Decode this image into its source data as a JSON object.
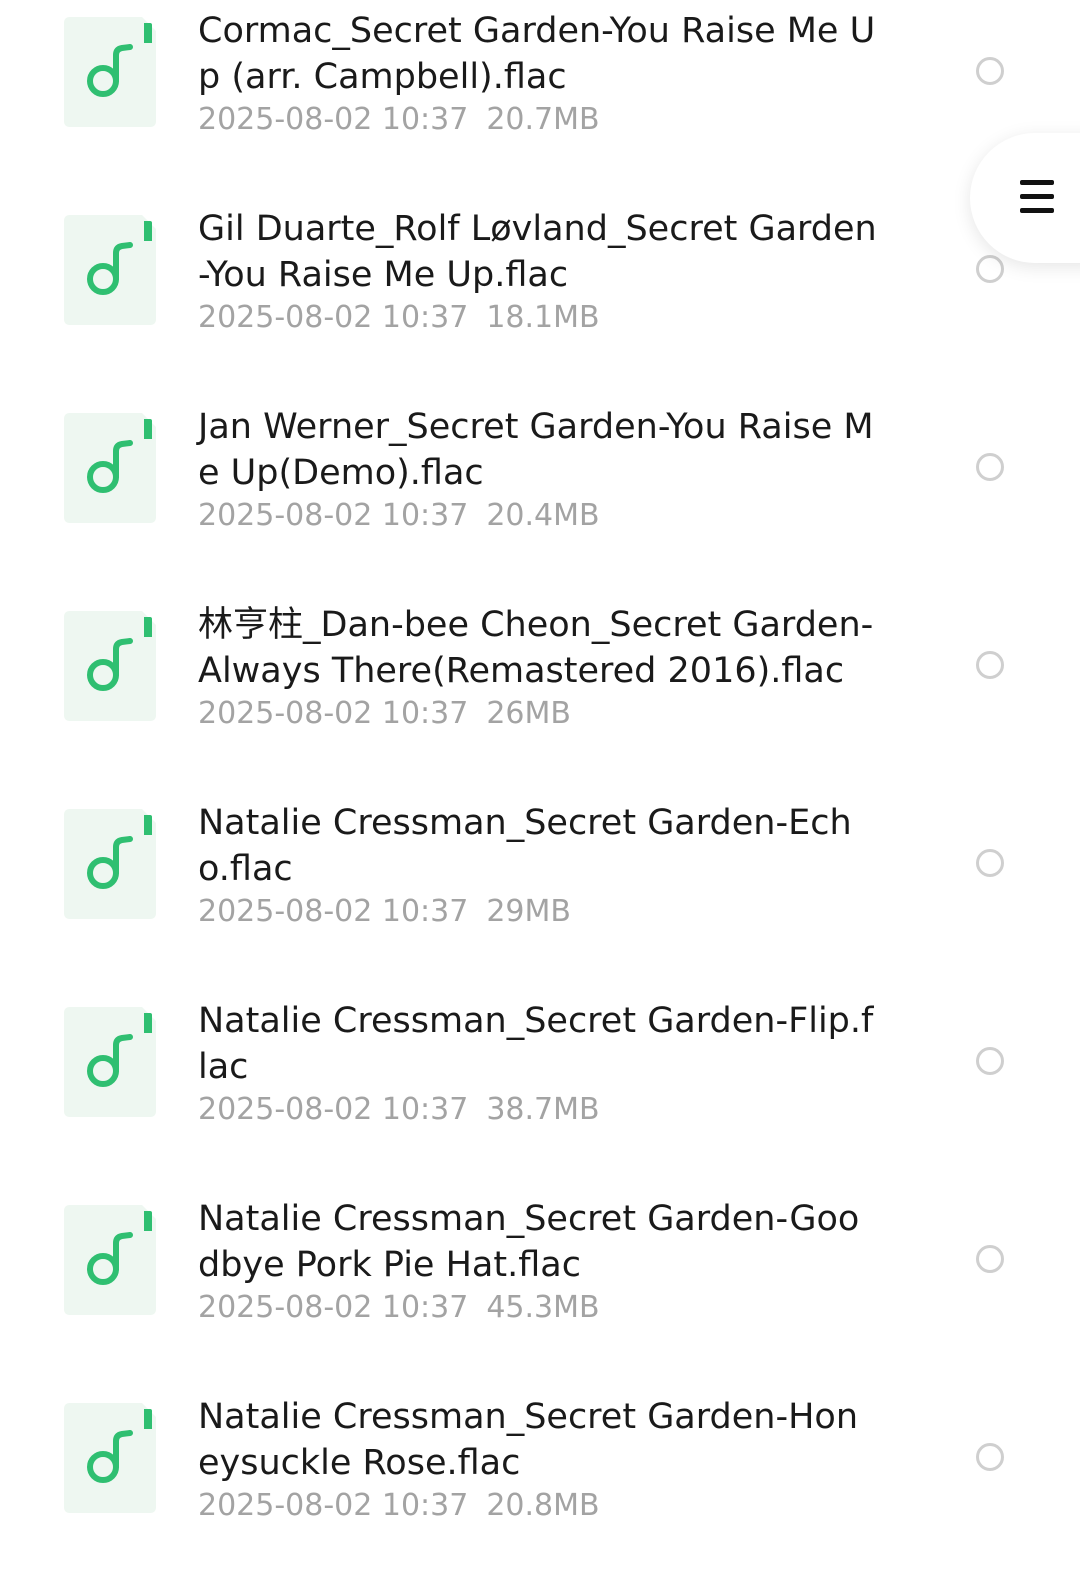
{
  "files": [
    {
      "name": "Cormac_Secret Garden-You Raise Me Up (arr. Campbell).flac",
      "date": "2025-08-02 10:37",
      "size": "20.7MB",
      "icon": "music-file-icon"
    },
    {
      "name": "Gil Duarte_Rolf Løvland_Secret Garden-You Raise Me Up.flac",
      "date": "2025-08-02 10:37",
      "size": "18.1MB",
      "icon": "music-file-icon"
    },
    {
      "name": "Jan Werner_Secret Garden-You Raise Me Up(Demo).flac",
      "date": "2025-08-02 10:37",
      "size": "20.4MB",
      "icon": "music-file-icon"
    },
    {
      "name": "林亨柱_Dan-bee Cheon_Secret Garden-Always There(Remastered 2016).flac",
      "date": "2025-08-02 10:37",
      "size": "26MB",
      "icon": "music-file-icon"
    },
    {
      "name": "Natalie Cressman_Secret Garden-Echo.flac",
      "date": "2025-08-02 10:37",
      "size": "29MB",
      "icon": "music-file-icon"
    },
    {
      "name": "Natalie Cressman_Secret Garden-Flip.flac",
      "date": "2025-08-02 10:37",
      "size": "38.7MB",
      "icon": "music-file-icon"
    },
    {
      "name": "Natalie Cressman_Secret Garden-Goodbye Pork Pie Hat.flac",
      "date": "2025-08-02 10:37",
      "size": "45.3MB",
      "icon": "music-file-icon"
    },
    {
      "name": "Natalie Cressman_Secret Garden-Honeysuckle Rose.flac",
      "date": "2025-08-02 10:37",
      "size": "20.8MB",
      "icon": "music-file-icon"
    }
  ],
  "menu_button": {
    "icon": "hamburger-menu-icon"
  },
  "colors": {
    "accent": "#2fbf71",
    "icon_bg": "#eef7f1",
    "text_primary": "#1a1a1a",
    "text_secondary": "#a3a3a3",
    "radio_border": "#cfcfcf"
  }
}
